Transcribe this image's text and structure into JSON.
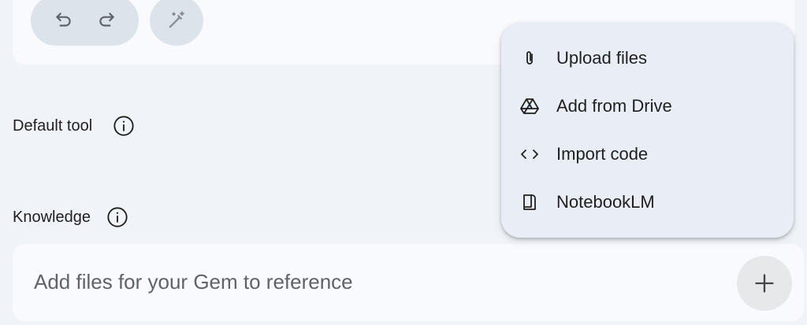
{
  "toolbar": {
    "undo_icon": "undo-icon",
    "redo_icon": "redo-icon",
    "magic_icon": "magic-wand-icon"
  },
  "default_tool": {
    "label": "Default tool",
    "info_icon": "info-icon"
  },
  "knowledge": {
    "label": "Knowledge",
    "info_icon": "info-icon",
    "placeholder": "Add files for your Gem to reference",
    "add_icon": "plus-icon"
  },
  "menu": {
    "items": [
      {
        "label": "Upload files",
        "icon": "paperclip-icon"
      },
      {
        "label": "Add from Drive",
        "icon": "drive-icon"
      },
      {
        "label": "Import code",
        "icon": "code-icon"
      },
      {
        "label": "NotebookLM",
        "icon": "notebook-icon"
      }
    ]
  },
  "colors": {
    "background": "#f0f4f9",
    "card": "#f8fafd",
    "menu": "#e9eef6",
    "pill": "#dde3ea",
    "text": "#1f1f1f",
    "placeholder": "#5f6368"
  }
}
